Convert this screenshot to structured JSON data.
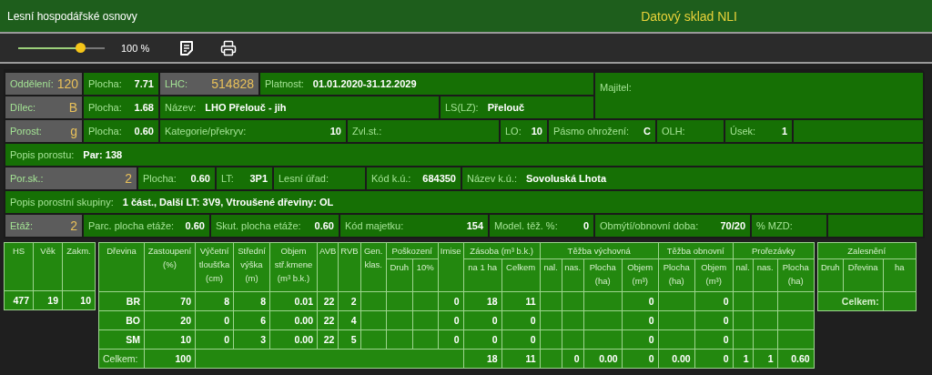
{
  "header": {
    "title": "Lesní hospodářské osnovy",
    "brand": "Datový sklad NLI"
  },
  "toolbar": {
    "zoom": {
      "level": 0.72,
      "reading": "100 %"
    }
  },
  "form": {
    "top_rows": [
      {
        "fields": [
          {
            "kind": "key",
            "label": "Oddělení:",
            "value": "120"
          },
          {
            "kind": "field",
            "label": "Plocha:",
            "value": "7.71"
          },
          {
            "kind": "key",
            "label": "LHC:",
            "value": "514828"
          },
          {
            "kind": "text",
            "label": "Platnost:",
            "value": "01.01.2020-31.12.2029"
          }
        ]
      },
      {
        "fields": [
          {
            "kind": "key",
            "label": "Dílec:",
            "value": "B"
          },
          {
            "kind": "field",
            "label": "Plocha:",
            "value": "1.68"
          },
          {
            "kind": "text",
            "label": "Název:",
            "value": "LHO Přelouč - jih"
          },
          {
            "kind": "text",
            "label": "LS(LZ):",
            "value": "Přelouč"
          }
        ]
      }
    ],
    "owner": {
      "label": "Majitel:"
    },
    "rows": [
      {
        "fields": [
          {
            "kind": "key",
            "label": "Porost:",
            "value": "g"
          },
          {
            "kind": "field",
            "label": "Plocha:",
            "value": "0.60"
          },
          {
            "kind": "field",
            "label": "Kategorie/překryv:",
            "value": "10"
          },
          {
            "kind": "field",
            "label": "Zvl.st.:"
          },
          {
            "kind": "field",
            "label": "LO:",
            "value": "10"
          },
          {
            "kind": "field",
            "label": "Pásmo ohrožení:",
            "value": "C"
          },
          {
            "kind": "field",
            "label": "OLH:"
          },
          {
            "kind": "field",
            "label": "Úsek:",
            "value": "1"
          },
          {
            "kind": "blank"
          }
        ]
      },
      {
        "fields": [
          {
            "kind": "text",
            "label": "Popis porostu:",
            "value": "Par: 138"
          }
        ]
      },
      {
        "fields": [
          {
            "kind": "key",
            "label": "Por.sk.:",
            "value": "2"
          },
          {
            "kind": "field",
            "label": "Plocha:",
            "value": "0.60"
          },
          {
            "kind": "field",
            "label": "LT:",
            "value": "3P1"
          },
          {
            "kind": "field",
            "label": "Lesní úřad:"
          },
          {
            "kind": "field",
            "label": "Kód k.ú.:",
            "value": "684350"
          },
          {
            "kind": "text",
            "label": "Název k.ú.:",
            "value": "Sovoluská Lhota"
          }
        ]
      },
      {
        "fields": [
          {
            "kind": "text",
            "label": "Popis porostní skupiny:",
            "value": "1 část., Další LT: 3V9, Vtroušené dřeviny: OL"
          }
        ]
      },
      {
        "fields": [
          {
            "kind": "key",
            "label": "Etáž:",
            "value": "2"
          },
          {
            "kind": "field",
            "label": "Parc. plocha etáže:",
            "value": "0.60"
          },
          {
            "kind": "field",
            "label": "Skut. plocha etáže:",
            "value": "0.60"
          },
          {
            "kind": "field",
            "label": "Kód majetku:",
            "value": "154"
          },
          {
            "kind": "field",
            "label": "Model. těž. %:",
            "value": "0"
          },
          {
            "kind": "field",
            "label": "Obmýtí/obnovní doba:",
            "value": "70/20"
          },
          {
            "kind": "field",
            "label": "% MZD:"
          },
          {
            "kind": "blank"
          }
        ]
      }
    ]
  },
  "stand_table": {
    "columns": [
      "HS",
      "Věk",
      "Zakm."
    ],
    "row": [
      "477",
      "19",
      "10"
    ]
  },
  "species_table": {
    "header": [
      {
        "label": "Dřevina"
      },
      {
        "label": "Zastoupení (%)"
      },
      {
        "label": "Výčetní tloušťka (cm)"
      },
      {
        "label": "Střední výška (m)"
      },
      {
        "label": "Objem stř.kmene (m³ b.k.)"
      },
      {
        "label": "AVB"
      },
      {
        "label": "RVB"
      },
      {
        "label": "Gen. klas."
      },
      {
        "label": "Poškození",
        "children": [
          "Druh",
          "10%"
        ]
      },
      {
        "label": "Imise"
      },
      {
        "label": "Zásoba (m³ b.k.)",
        "children": [
          "na 1 ha",
          "Celkem"
        ]
      },
      {
        "label": "Těžba výchovná",
        "children": [
          "nal.",
          "nas.",
          "Plocha (ha)",
          "Objem (m³)"
        ]
      },
      {
        "label": "Těžba obnovní",
        "children": [
          "Plocha (ha)",
          "Objem (m³)"
        ]
      },
      {
        "label": "Prořezávky",
        "children": [
          "nal.",
          "nas.",
          "Plocha (ha)"
        ]
      }
    ],
    "rows": [
      [
        "BR",
        "70",
        "8",
        "8",
        "0.01",
        "22",
        "2",
        "",
        "",
        "",
        "0",
        "18",
        "11",
        "",
        "",
        "",
        "0",
        "",
        "0",
        "",
        "",
        ""
      ],
      [
        "BO",
        "20",
        "0",
        "6",
        "0.00",
        "22",
        "4",
        "",
        "",
        "",
        "0",
        "0",
        "0",
        "",
        "",
        "",
        "0",
        "",
        "0",
        "",
        "",
        ""
      ],
      [
        "SM",
        "10",
        "0",
        "3",
        "0.00",
        "22",
        "5",
        "",
        "",
        "",
        "0",
        "0",
        "0",
        "",
        "",
        "",
        "0",
        "",
        "0",
        "",
        "",
        ""
      ]
    ],
    "total": {
      "label": "Celkem:",
      "share": "100",
      "stock_values": [
        "18",
        "11"
      ],
      "harvest_values": [
        "0",
        "0.00",
        "0",
        "0.00",
        "0",
        "1",
        "1",
        "0.60"
      ]
    }
  },
  "afforestation_table": {
    "title": "Zalesnění",
    "columns": [
      "Druh",
      "Dřevina",
      "ha"
    ],
    "total_label": "Celkem:"
  }
}
